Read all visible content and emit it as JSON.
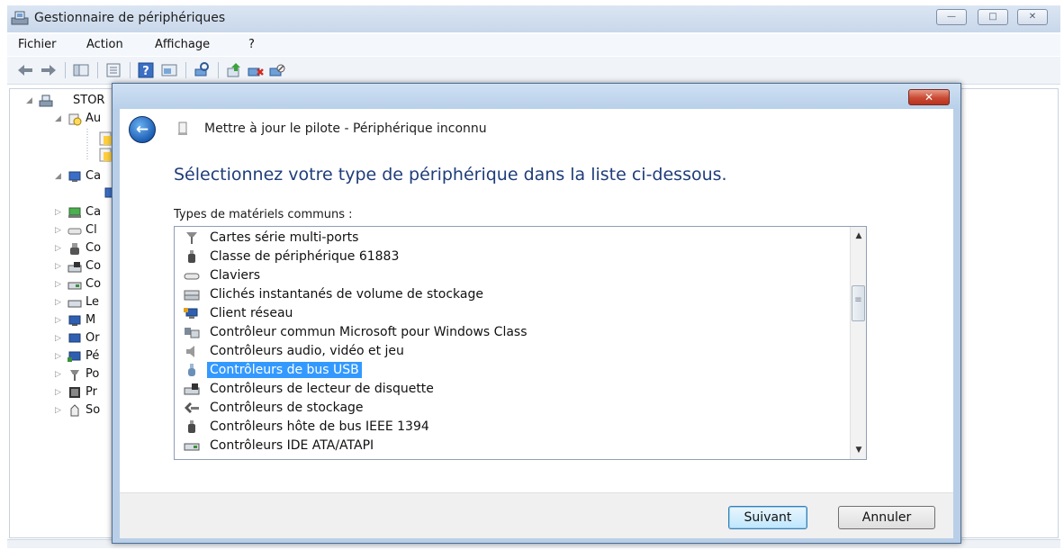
{
  "window": {
    "title": "Gestionnaire de périphériques",
    "controls": {
      "minimize": "—",
      "maximize": "□",
      "close": "✕"
    }
  },
  "menubar": {
    "items": [
      "Fichier",
      "Action",
      "Affichage",
      "?"
    ]
  },
  "toolbar": {
    "icons": [
      "back-icon",
      "forward-icon",
      "show-hide-tree-icon",
      "properties-icon",
      "help-icon",
      "view-icon",
      "scan-hardware-icon",
      "update-driver-icon",
      "uninstall-icon",
      "disable-icon"
    ]
  },
  "tree": {
    "root": "STOR",
    "items": [
      "Au",
      "Ca",
      "Ca",
      "Cl",
      "Co",
      "Co",
      "Co",
      "Le",
      "M",
      "Or",
      "Pé",
      "Po",
      "Pr",
      "So"
    ]
  },
  "dialog": {
    "close": "✕",
    "back": "←",
    "header_title": "Mettre à jour le pilote - Périphérique inconnu",
    "heading": "Sélectionnez votre type de périphérique dans la liste ci-dessous.",
    "list_label": "Types de matériels communs :",
    "list_items": [
      {
        "label": "Cartes série multi-ports",
        "icon": "serial-card-icon"
      },
      {
        "label": "Classe de périphérique 61883",
        "icon": "device-class-icon"
      },
      {
        "label": "Claviers",
        "icon": "keyboard-icon"
      },
      {
        "label": "Clichés instantanés de volume de stockage",
        "icon": "storage-snapshot-icon"
      },
      {
        "label": "Client réseau",
        "icon": "network-client-icon"
      },
      {
        "label": "Contrôleur commun Microsoft pour Windows Class",
        "icon": "microsoft-controller-icon"
      },
      {
        "label": "Contrôleurs audio, vidéo et jeu",
        "icon": "audio-icon"
      },
      {
        "label": "Contrôleurs de bus USB",
        "icon": "usb-icon",
        "selected": true
      },
      {
        "label": "Contrôleurs de lecteur de disquette",
        "icon": "floppy-controller-icon"
      },
      {
        "label": "Contrôleurs de stockage",
        "icon": "storage-controller-icon"
      },
      {
        "label": "Contrôleurs hôte de bus IEEE 1394",
        "icon": "ieee1394-icon"
      },
      {
        "label": "Contrôleurs IDE ATA/ATAPI",
        "icon": "ide-controller-icon"
      },
      {
        "label": "",
        "icon": "partial-item-icon"
      }
    ],
    "scroll": {
      "up": "▲",
      "down": "▼",
      "grip": "≡"
    },
    "next_label": "Suivant",
    "cancel_label": "Annuler"
  },
  "colors": {
    "selection": "#3399ff",
    "heading": "#1f3d7a",
    "dialog_frame": "#b9cfe8"
  }
}
